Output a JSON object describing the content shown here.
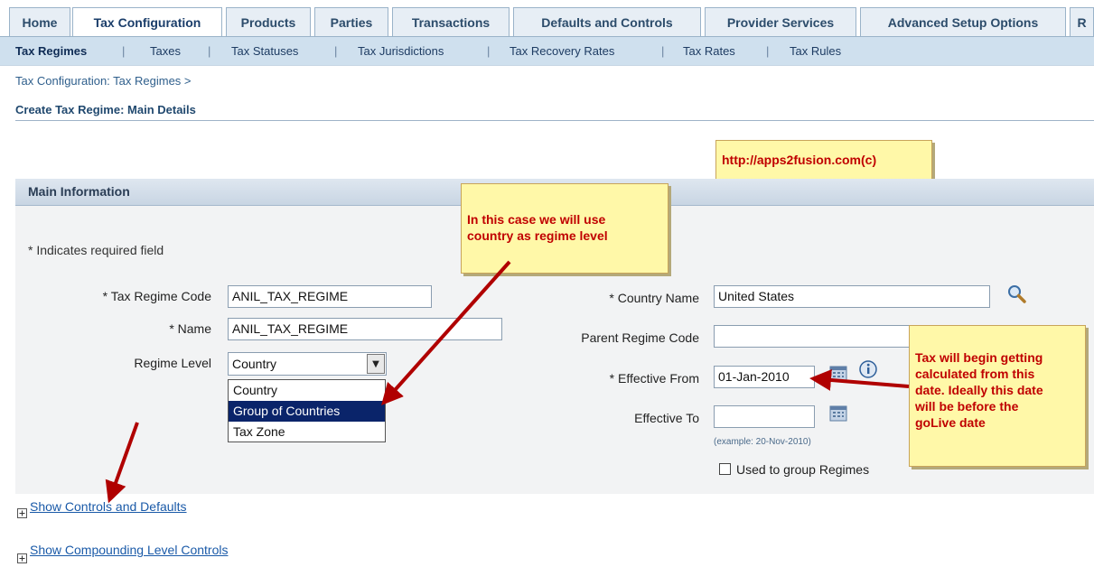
{
  "tabs": [
    "Home",
    "Tax Configuration",
    "Products",
    "Parties",
    "Transactions",
    "Defaults and Controls",
    "Provider Services",
    "Advanced Setup Options",
    "R"
  ],
  "subtabs": [
    "Tax Regimes",
    "Taxes",
    "Tax Statuses",
    "Tax Jurisdictions",
    "Tax Recovery Rates",
    "Tax Rates",
    "Tax Rules"
  ],
  "breadcrumb": "Tax Configuration: Tax Regimes  >",
  "page_title": "Create Tax Regime: Main Details",
  "watermark": "http://apps2fusion.com(c)",
  "section_title": "Main Information",
  "required_note": "* Indicates required field",
  "form": {
    "tax_regime_code_label": "* Tax Regime Code",
    "tax_regime_code_value": "ANIL_TAX_REGIME",
    "name_label": "* Name",
    "name_value": "ANIL_TAX_REGIME",
    "regime_level_label": "Regime Level",
    "regime_level_value": "Country",
    "regime_level_options": [
      "Country",
      "Group of Countries",
      "Tax Zone"
    ],
    "country_name_label": "* Country Name",
    "country_name_value": "United States",
    "parent_regime_code_label": "Parent Regime Code",
    "parent_regime_code_value": "",
    "effective_from_label": "* Effective From",
    "effective_from_value": "01-Jan-2010",
    "effective_to_label": "Effective To",
    "effective_to_value": "",
    "date_hint": "(example: 20-Nov-2010)",
    "used_to_group_label": "Used to group Regimes"
  },
  "callouts": {
    "regime_level_line1": "In this case we will use",
    "regime_level_line2": "country as regime level",
    "date_line1": "Tax will begin getting",
    "date_line2": "calculated from this",
    "date_line3": "date. Ideally this date",
    "date_line4": "will be before the",
    "date_line5": "goLive date"
  },
  "links": {
    "show_controls": "Show Controls and Defaults",
    "show_compounding": "Show Compounding Level Controls"
  },
  "colors": {
    "accent_blue": "#1a3d6a",
    "callout_bg": "#fff8a8",
    "callout_text": "#c00000",
    "arrow_red": "#b00000"
  }
}
